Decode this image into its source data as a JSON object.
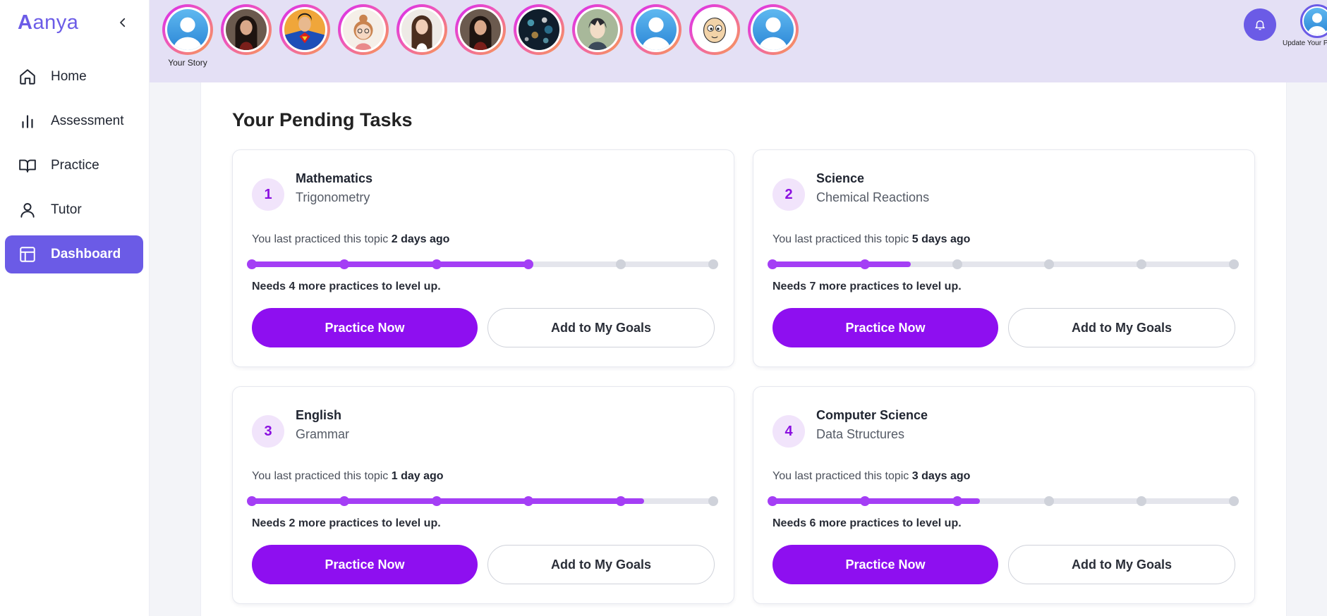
{
  "brand": {
    "first_letter": "A",
    "rest": "anya"
  },
  "sidebar": {
    "items": [
      {
        "label": "Home",
        "icon": "home-icon",
        "active": false
      },
      {
        "label": "Assessment",
        "icon": "bar-chart-icon",
        "active": false
      },
      {
        "label": "Practice",
        "icon": "book-icon",
        "active": false
      },
      {
        "label": "Tutor",
        "icon": "user-icon",
        "active": false
      },
      {
        "label": "Dashboard",
        "icon": "layout-icon",
        "active": true
      }
    ]
  },
  "stories": [
    {
      "label": "Your Story",
      "avatar": "default-user"
    },
    {
      "label": "",
      "avatar": "woman-dark-hair"
    },
    {
      "label": "",
      "avatar": "superhero"
    },
    {
      "label": "",
      "avatar": "cartoon-girl"
    },
    {
      "label": "",
      "avatar": "woman-brunette"
    },
    {
      "label": "",
      "avatar": "woman-dark-hair"
    },
    {
      "label": "",
      "avatar": "city-lights"
    },
    {
      "label": "",
      "avatar": "anime-boy"
    },
    {
      "label": "",
      "avatar": "default-user"
    },
    {
      "label": "",
      "avatar": "cartoon-face"
    },
    {
      "label": "",
      "avatar": "default-user"
    }
  ],
  "profile": {
    "label": "Update Your Pr"
  },
  "main": {
    "title": "Your Pending Tasks",
    "tasks": [
      {
        "number": "1",
        "subject": "Mathematics",
        "topic": "Trigonometry",
        "last_prefix": "You last practiced this topic",
        "last_value": "2 days ago",
        "progress": 0.6,
        "completed_dots": 4,
        "total_dots": 6,
        "needs": "Needs 4 more practices to level up.",
        "practice_label": "Practice Now",
        "goal_label": "Add to My Goals"
      },
      {
        "number": "2",
        "subject": "Science",
        "topic": "Chemical Reactions",
        "last_prefix": "You last practiced this topic",
        "last_value": "5 days ago",
        "progress": 0.3,
        "completed_dots": 2,
        "total_dots": 6,
        "needs": "Needs 7 more practices to level up.",
        "practice_label": "Practice Now",
        "goal_label": "Add to My Goals"
      },
      {
        "number": "3",
        "subject": "English",
        "topic": "Grammar",
        "last_prefix": "You last practiced this topic",
        "last_value": "1 day ago",
        "progress": 0.85,
        "completed_dots": 5,
        "total_dots": 6,
        "needs": "Needs 2 more practices to level up.",
        "practice_label": "Practice Now",
        "goal_label": "Add to My Goals"
      },
      {
        "number": "4",
        "subject": "Computer Science",
        "topic": "Data Structures",
        "last_prefix": "You last practiced this topic",
        "last_value": "3 days ago",
        "progress": 0.45,
        "completed_dots": 3,
        "total_dots": 6,
        "needs": "Needs 6 more practices to level up.",
        "practice_label": "Practice Now",
        "goal_label": "Add to My Goals"
      }
    ]
  },
  "colors": {
    "accent": "#6b5be6",
    "purple": "#8e0ff0",
    "progress": "#a43ef5",
    "track": "#e4e5ec",
    "topbar": "#e4e0f5"
  }
}
